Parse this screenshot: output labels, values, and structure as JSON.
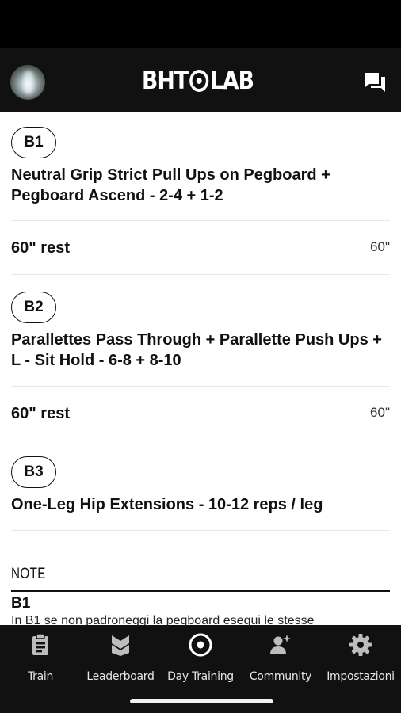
{
  "header": {
    "logo_left": "BHT",
    "logo_right": "LAB"
  },
  "blocks": [
    {
      "badge": "B1",
      "title": "Neutral Grip Strict Pull Ups on Pegboard + Pegboard Ascend - 2-4 + 1-2",
      "rest_label": "60\" rest",
      "rest_value": "60\""
    },
    {
      "badge": "B2",
      "title": "Parallettes Pass Through + Parallette Push Ups + L - Sit Hold - 6-8 + 8-10",
      "rest_label": "60\" rest",
      "rest_value": "60\""
    },
    {
      "badge": "B3",
      "title": "One-Leg Hip Extensions - 10-12 reps / leg"
    }
  ],
  "notes": {
    "heading": "NOTE",
    "block": "B1",
    "text": "In B1 se non padroneggi la pegboard esegui le stesse"
  },
  "tabs": [
    {
      "label": "Train",
      "icon": "clipboard-icon"
    },
    {
      "label": "Leaderboard",
      "icon": "chevron-badge-icon"
    },
    {
      "label": "Day Training",
      "icon": "target-icon"
    },
    {
      "label": "Community",
      "icon": "community-icon"
    },
    {
      "label": "Impostazioni",
      "icon": "gear-icon"
    }
  ],
  "colors": {
    "header_bg": "#111111",
    "tab_bar_bg": "#111111",
    "text": "#111111"
  }
}
